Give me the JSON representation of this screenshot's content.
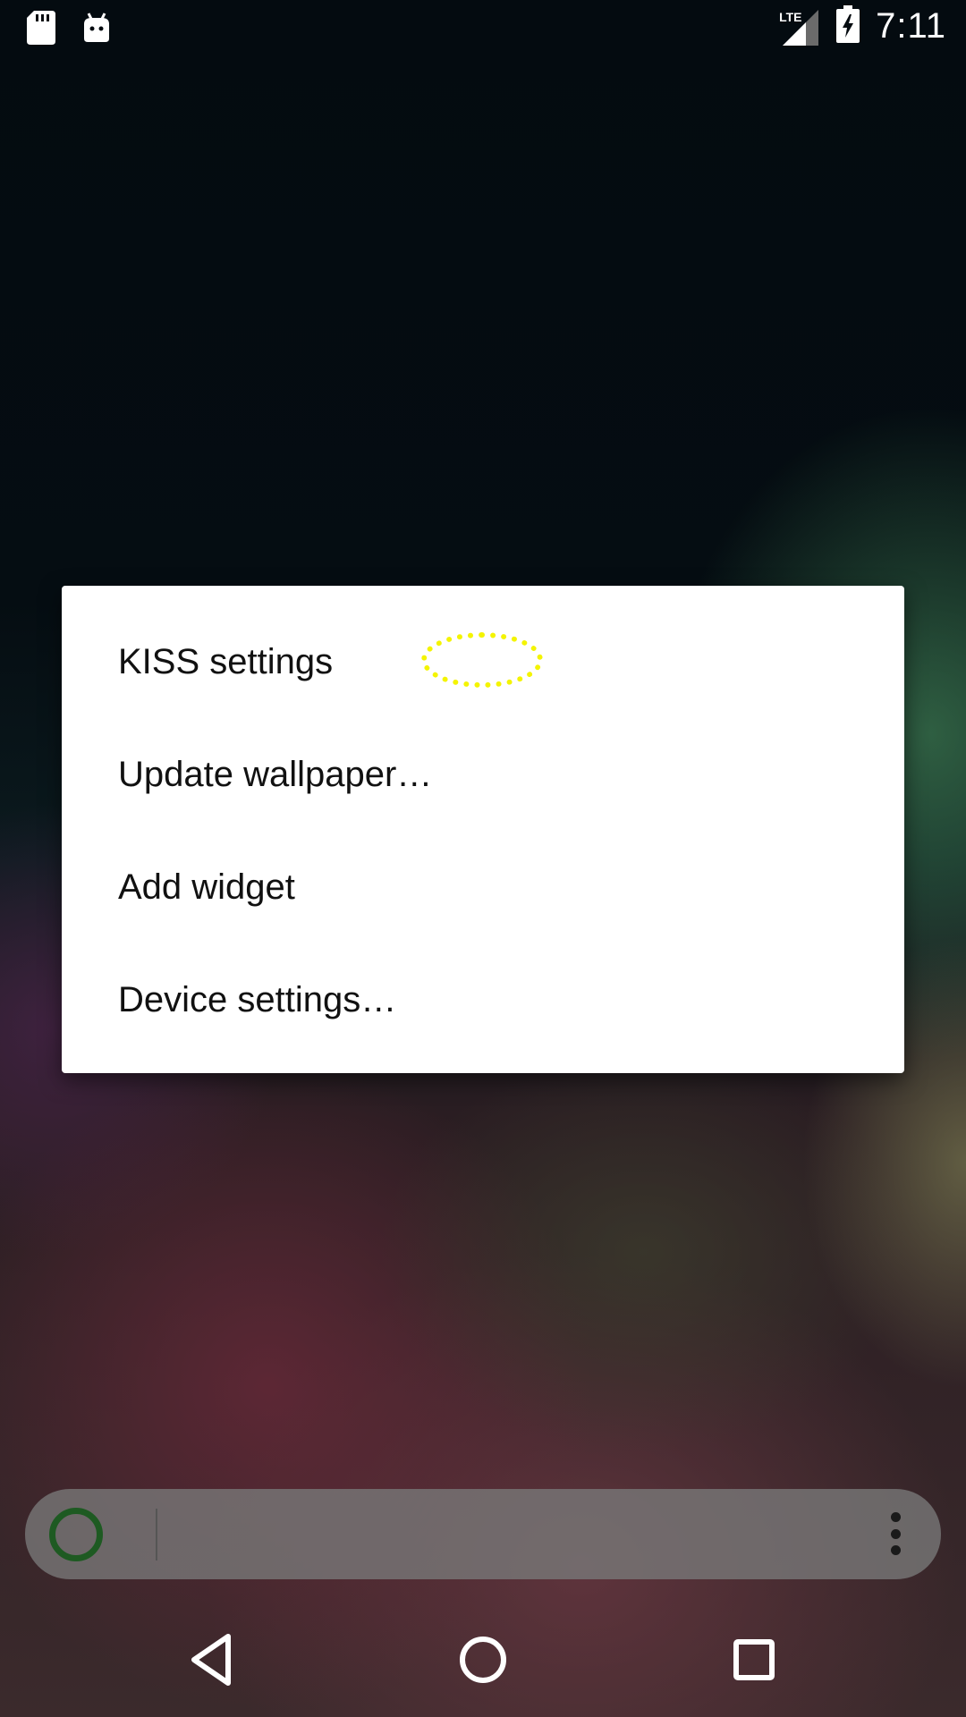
{
  "status_bar": {
    "time": "7:11",
    "network": "LTE",
    "icons": [
      "sd-card-icon",
      "android-debug-icon",
      "lte-signal-icon",
      "battery-charging-icon"
    ]
  },
  "context_menu": {
    "items": [
      {
        "label": "KISS settings"
      },
      {
        "label": "Update wallpaper…"
      },
      {
        "label": "Add widget"
      },
      {
        "label": "Device settings…"
      }
    ]
  },
  "search_bar": {
    "value": "",
    "placeholder": "",
    "icons": [
      "launcher-ring-icon",
      "overflow-menu-icon"
    ],
    "accent_color": "#1e5a22"
  },
  "nav_bar": {
    "icons": [
      "back-icon",
      "home-icon",
      "recents-icon"
    ]
  },
  "touch_indicator_color": "#f4f400"
}
